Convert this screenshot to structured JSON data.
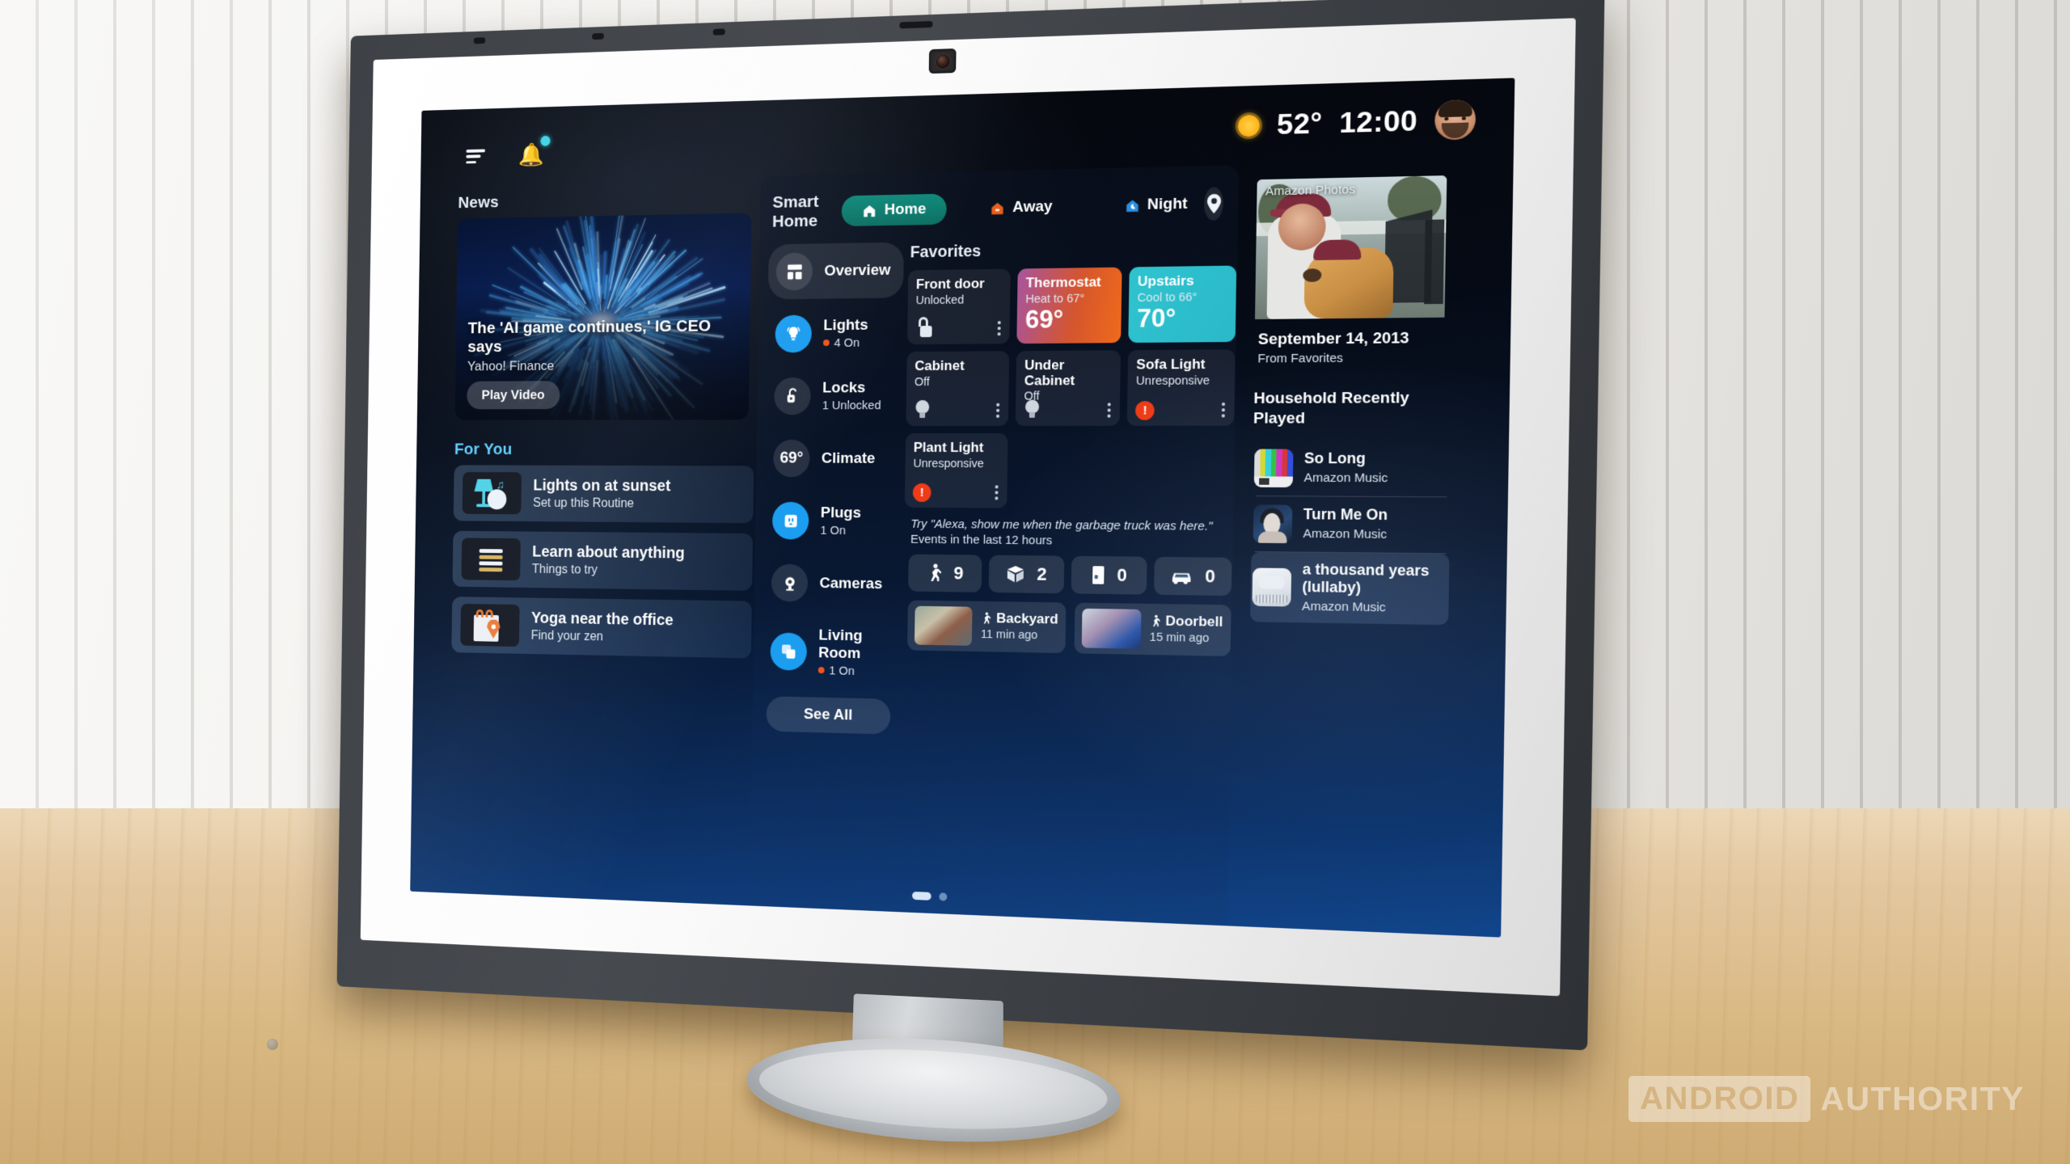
{
  "status_bar": {
    "menu_icon": "hamburger-menu-icon",
    "notification_icon": "bell-icon",
    "weather_icon": "sun-icon",
    "temperature": "52°",
    "time": "12:00",
    "avatar": "user-avatar"
  },
  "news": {
    "section_label": "News",
    "headline": "The 'AI game continues,' IG CEO says",
    "source": "Yahoo! Finance",
    "play_button": "Play Video"
  },
  "for_you": {
    "section_label": "For You",
    "items": [
      {
        "title": "Lights on at sunset",
        "subtitle": "Set up this Routine",
        "icon": "lamp-music-icon"
      },
      {
        "title": "Learn about anything",
        "subtitle": "Things to try",
        "icon": "book-icon"
      },
      {
        "title": "Yoga near the office",
        "subtitle": "Find your zen",
        "icon": "shopping-bag-pin-icon"
      }
    ]
  },
  "smart_home": {
    "title": "Smart Home",
    "modes": [
      {
        "label": "Home",
        "icon": "house-icon",
        "active": true,
        "color": "#0f8a7a"
      },
      {
        "label": "Away",
        "icon": "house-arrow-icon",
        "active": false,
        "color": "#e8601c"
      },
      {
        "label": "Night",
        "icon": "house-moon-icon",
        "active": false,
        "color": "#2a8fe0"
      }
    ],
    "pin_icon": "location-pin-icon",
    "nav": [
      {
        "name": "Overview",
        "sub": "",
        "icon": "dashboard-icon",
        "selected": true,
        "accent": false
      },
      {
        "name": "Lights",
        "sub": "4 On",
        "icon": "bulb-icon",
        "selected": false,
        "accent": true
      },
      {
        "name": "Locks",
        "sub": "1 Unlocked",
        "icon": "unlock-icon",
        "selected": false,
        "accent": false
      },
      {
        "name": "Climate",
        "sub": "",
        "icon": "temperature-69-icon",
        "selected": false,
        "accent": false
      },
      {
        "name": "Plugs",
        "sub": "1 On",
        "icon": "outlet-icon",
        "selected": false,
        "accent": true
      },
      {
        "name": "Cameras",
        "sub": "",
        "icon": "camera-icon",
        "selected": false,
        "accent": false
      },
      {
        "name": "Living Room",
        "sub": "1 On",
        "icon": "group-icon",
        "selected": false,
        "accent": true
      }
    ],
    "climate_value": "69°",
    "see_all": "See All",
    "favorites_label": "Favorites",
    "favorites": [
      {
        "name": "Front door",
        "status": "Unlocked",
        "value": "",
        "style": "dark",
        "icon": "unlock-icon",
        "error": false
      },
      {
        "name": "Thermostat",
        "status": "Heat to 67°",
        "value": "69°",
        "style": "thermo",
        "icon": "",
        "error": false
      },
      {
        "name": "Upstairs",
        "status": "Cool to 66°",
        "value": "70°",
        "style": "upstairs",
        "icon": "",
        "error": false
      },
      {
        "name": "Cabinet",
        "status": "Off",
        "value": "",
        "style": "dark",
        "icon": "bulb-icon",
        "error": false
      },
      {
        "name": "Under Cabinet",
        "status": "Off",
        "value": "",
        "style": "dark",
        "icon": "bulb-icon",
        "error": false
      },
      {
        "name": "Sofa Light",
        "status": "Unresponsive",
        "value": "",
        "style": "dark",
        "icon": "",
        "error": true
      },
      {
        "name": "Plant Light",
        "status": "Unresponsive",
        "value": "",
        "style": "dark",
        "icon": "",
        "error": true
      }
    ],
    "alexa_hint": "Try \"Alexa, show me when the garbage truck was here.\"",
    "events_label": "Events in the last 12 hours",
    "event_chips": [
      {
        "icon": "person-icon",
        "count": "9"
      },
      {
        "icon": "package-icon",
        "count": "2"
      },
      {
        "icon": "door-icon",
        "count": "0"
      },
      {
        "icon": "car-icon",
        "count": "0"
      }
    ],
    "clips": [
      {
        "name": "Backyard",
        "time": "11 min ago",
        "icon": "person-icon"
      },
      {
        "name": "Doorbell",
        "time": "15 min ago",
        "icon": "person-icon"
      }
    ],
    "page_indicator": {
      "pages": 2,
      "active": 0
    }
  },
  "right_panel": {
    "photos": {
      "label": "Amazon Photos",
      "date": "September 14, 2013",
      "from": "From Favorites"
    },
    "recently_played": {
      "title": "Household Recently Played",
      "items": [
        {
          "name": "So Long",
          "source": "Amazon Music",
          "art": "color-bars"
        },
        {
          "name": "Turn Me On",
          "source": "Amazon Music",
          "art": "woman-portrait"
        },
        {
          "name": "a thousand years (lullaby)",
          "source": "Amazon Music",
          "art": "echo-device"
        }
      ]
    }
  },
  "watermark": {
    "box": "ANDROID",
    "text": "AUTHORITY"
  }
}
